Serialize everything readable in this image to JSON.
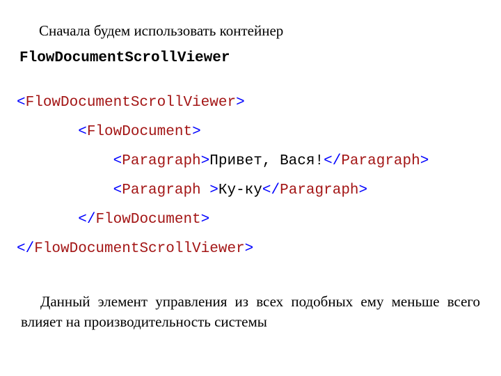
{
  "intro": "Сначала будем использовать контейнер",
  "subhead": "FlowDocumentScrollViewer",
  "code": {
    "l1": {
      "open": "<",
      "tag": "FlowDocumentScrollViewer",
      "close": ">"
    },
    "l2": {
      "indent": "       ",
      "open": "<",
      "tag": "FlowDocument",
      "close": ">"
    },
    "l3": {
      "indent": "           ",
      "open": "<",
      "tag": "Paragraph",
      "gt": ">",
      "text": "Привет, Вася!",
      "open2": "</",
      "tag2": "Paragraph",
      "close2": ">"
    },
    "l4": {
      "indent": "           ",
      "open": "<",
      "tag": "Paragraph ",
      "gt": ">",
      "text": "Ку-ку",
      "open2": "</",
      "tag2": "Paragraph",
      "close2": ">"
    },
    "l5": {
      "indent": "       ",
      "open": "</",
      "tag": "FlowDocument",
      "close": ">"
    },
    "l6": {
      "open": "</",
      "tag": "FlowDocumentScrollViewer",
      "close": ">"
    }
  },
  "outro": "Данный элемент управления из всех подобных ему меньше всего влияет на производительность системы"
}
